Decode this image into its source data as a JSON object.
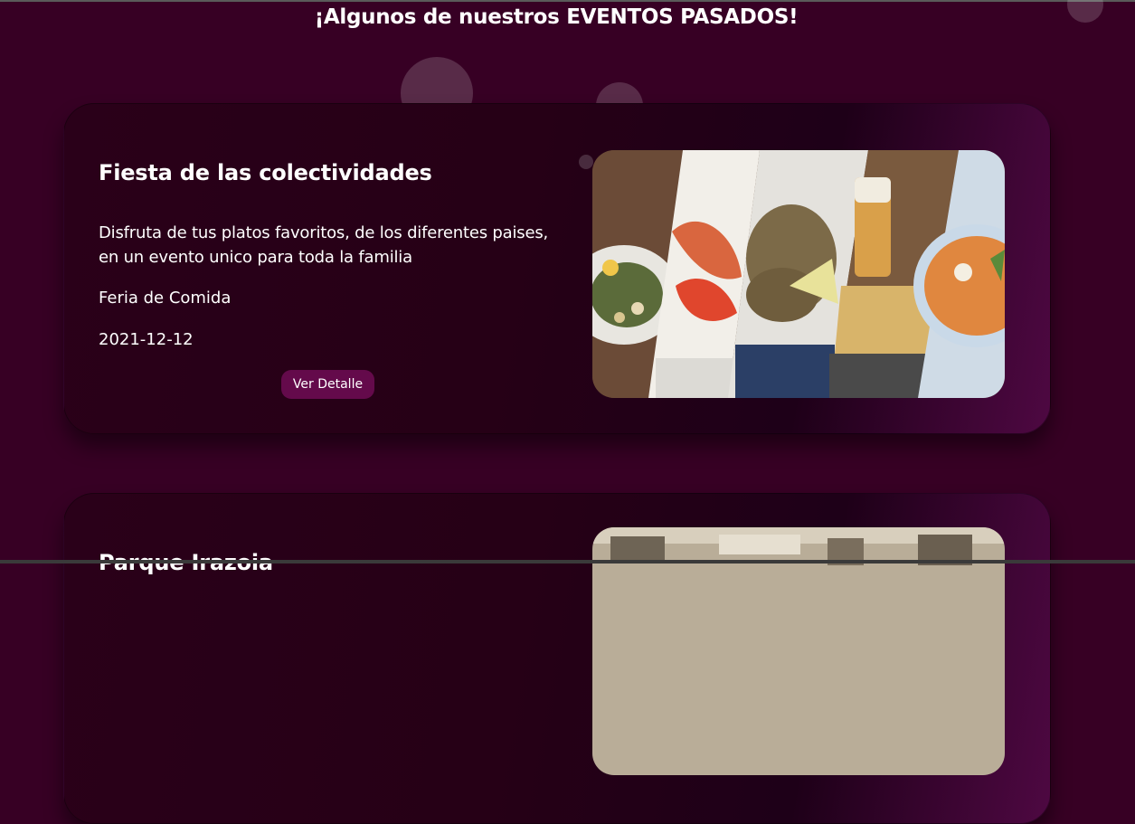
{
  "section": {
    "title": "¡Algunos de nuestros EVENTOS PASADOS!"
  },
  "events": [
    {
      "title": "Fiesta de las colectividades",
      "description": "Disfruta de tus platos favoritos, de los diferentes paises, en un evento unico para toda la familia",
      "type": "Feria de Comida",
      "date": "2021-12-12",
      "button_label": "Ver Detalle"
    },
    {
      "title": "Parque Irazoia"
    }
  ],
  "colors": {
    "background": "#370024",
    "card": "#260016",
    "button": "#640a4b",
    "text": "#ffffff"
  }
}
